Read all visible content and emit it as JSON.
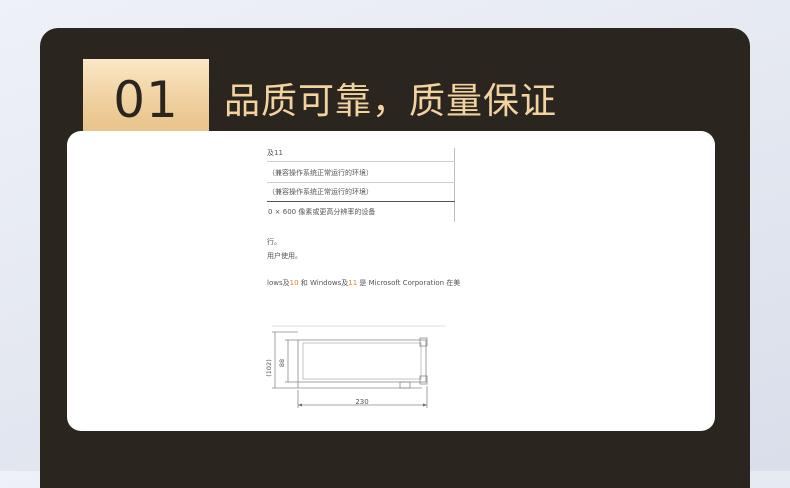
{
  "section": {
    "number": "01",
    "title": "品质可靠，质量保证"
  },
  "doc": {
    "table_rows": [
      "及11",
      "（兼容操作系统正常运行的环境）",
      "（兼容操作系统正常运行的环境）",
      "0 × 600 像素或更高分辨率的设备"
    ],
    "note_1": "行。",
    "note_2": "用户使用。",
    "trademark": {
      "prefix": "lows及",
      "hl_1": "10",
      "mid_1": " 和 Windows及",
      "hl_2": "11",
      "mid_2": " 是 Microsoft Corporation 在美"
    }
  },
  "drawing": {
    "dim_102": "(102)",
    "dim_88": "88",
    "dim_230": "230"
  },
  "colors": {
    "panel": "#2b2520",
    "accent_gold": "#f2d3a0",
    "badge_gold": "#efcf9c",
    "highlight": "#d88a20"
  }
}
